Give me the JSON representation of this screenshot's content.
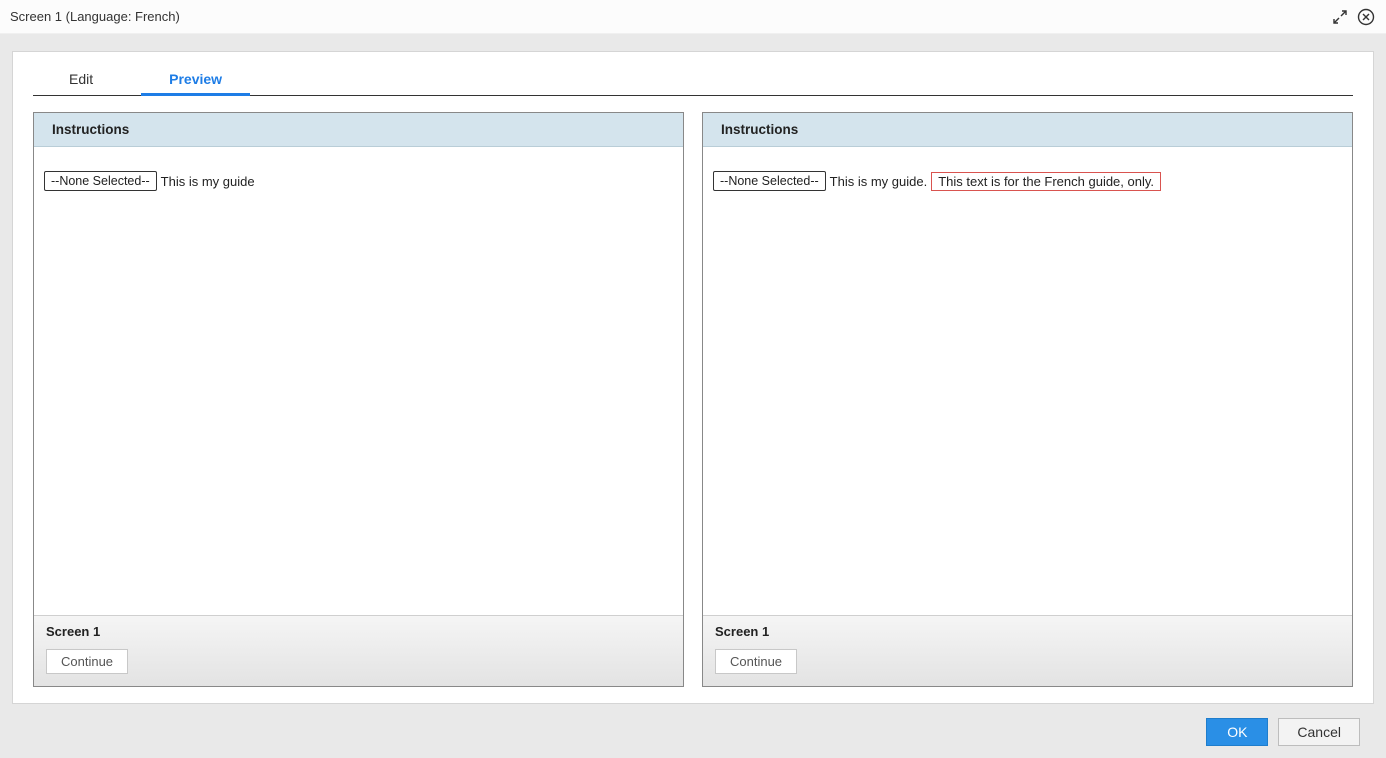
{
  "window": {
    "title": "Screen 1 (Language: French)"
  },
  "tabs": {
    "edit": "Edit",
    "preview": "Preview",
    "active": "preview"
  },
  "panels": {
    "left": {
      "header": "Instructions",
      "dropdown": "--None Selected--",
      "text": "This is my guide",
      "footer_label": "Screen 1",
      "continue": "Continue"
    },
    "right": {
      "header": "Instructions",
      "dropdown": "--None Selected--",
      "text": "This is my guide.",
      "highlight": "This text is for the French guide, only.",
      "footer_label": "Screen 1",
      "continue": "Continue"
    }
  },
  "buttons": {
    "ok": "OK",
    "cancel": "Cancel"
  }
}
